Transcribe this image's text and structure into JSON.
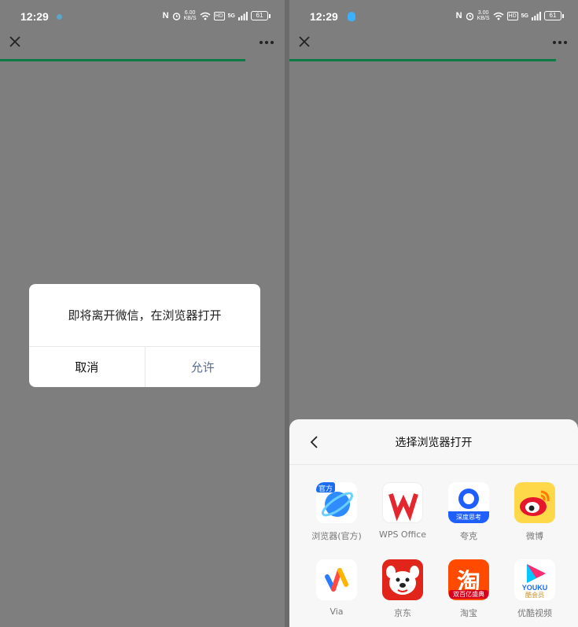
{
  "status_left": {
    "time": "12:29",
    "speed": "6.00\nKB/S",
    "signal": "5G",
    "battery": "61"
  },
  "status_right": {
    "time": "12:29",
    "speed": "3.00\nKB/S",
    "signal": "5G",
    "battery": "61"
  },
  "nav": {
    "close_icon": "close-icon",
    "more_icon": "more-icon"
  },
  "dialog": {
    "message": "即将离开微信，在浏览器打开",
    "cancel_label": "取消",
    "allow_label": "允许"
  },
  "sheet": {
    "title": "选择浏览器打开",
    "apps": [
      {
        "label": "浏览器(官方)",
        "icon": "browser-icon",
        "badge": "官方"
      },
      {
        "label": "WPS Office",
        "icon": "wps-icon"
      },
      {
        "label": "夸克",
        "icon": "quark-icon",
        "badge": "深度思考"
      },
      {
        "label": "微博",
        "icon": "weibo-icon"
      },
      {
        "label": "Via",
        "icon": "via-icon"
      },
      {
        "label": "京东",
        "icon": "jd-icon"
      },
      {
        "label": "淘宝",
        "icon": "taobao-icon",
        "char": "淘",
        "badge": "双百亿盛典"
      },
      {
        "label": "优酷视频",
        "icon": "youku-icon",
        "brand": "YOUKU",
        "badge": "酷会员"
      }
    ]
  },
  "colors": {
    "progress": "#0e7a46",
    "allow_text": "#576b95",
    "overlay": "#7e7e7e"
  }
}
